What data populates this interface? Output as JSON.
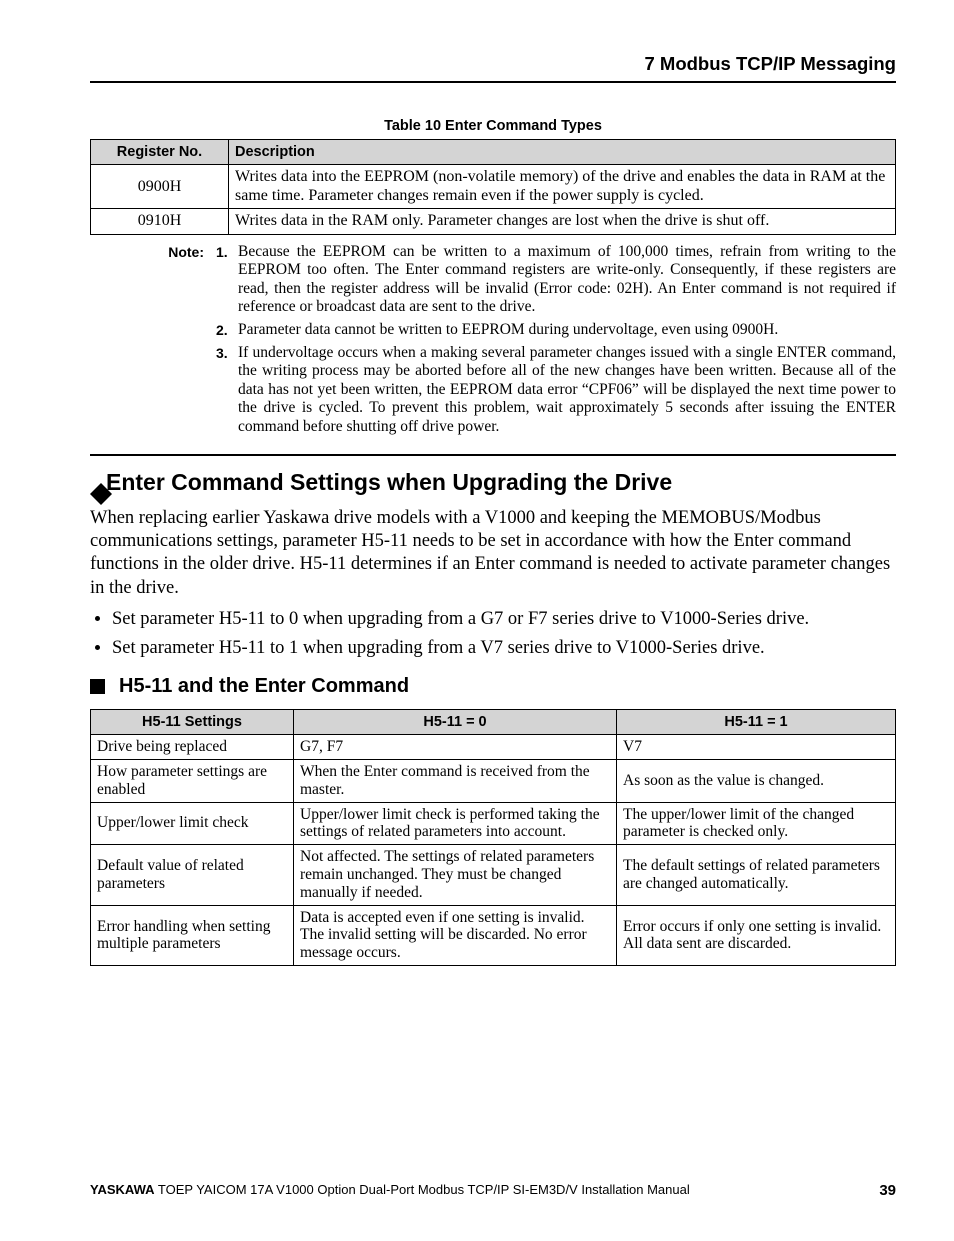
{
  "header": {
    "title": "7  Modbus TCP/IP Messaging"
  },
  "table10": {
    "caption": "Table 10   Enter Command Types",
    "headers": {
      "reg": "Register No.",
      "desc": "Description"
    },
    "rows": [
      {
        "reg": "0900H",
        "desc": "Writes data into the EEPROM (non-volatile memory) of the drive and enables the data in RAM at the same time. Parameter changes remain even if the power supply is cycled."
      },
      {
        "reg": "0910H",
        "desc": "Writes data in the RAM only. Parameter changes are lost when the drive is shut off."
      }
    ]
  },
  "notes": {
    "label": "Note:",
    "items": [
      "Because the EEPROM can be written to a maximum of 100,000 times, refrain from writing to the EEPROM too often. The Enter command registers are write-only. Consequently, if these registers are read, then the register address will be invalid (Error code: 02H). An Enter command is not required if reference or broadcast data are sent to the drive.",
      "Parameter data cannot be written to EEPROM during undervoltage, even using 0900H.",
      "If undervoltage occurs when a making several parameter changes issued with a single ENTER command, the writing process may be aborted before all of the new changes have been written. Because all of the data has not yet been written, the EEPROM data error “CPF06” will be displayed the next time power to the drive is cycled. To prevent this problem, wait approximately 5 seconds after issuing the ENTER command before shutting off drive power."
    ]
  },
  "section": {
    "h2": "Enter Command Settings when Upgrading the Drive",
    "para": "When replacing earlier Yaskawa drive models with a V1000 and keeping the MEMOBUS/Modbus communications settings, parameter H5-11 needs to be set in accordance with how the Enter command functions in the older drive. H5-11 determines if an Enter command is needed to activate parameter changes in the drive.",
    "bullets": [
      "Set parameter H5-11 to 0 when upgrading from a G7 or F7 series drive to V1000-Series drive.",
      "Set parameter H5-11 to 1 when upgrading from a V7 series drive to V1000-Series drive."
    ],
    "h3": "H5-11 and the Enter Command"
  },
  "table11": {
    "headers": {
      "a": "H5-11 Settings",
      "b": "H5-11 = 0",
      "c": "H5-11 = 1"
    },
    "rows": [
      {
        "a": "Drive being replaced",
        "b": "G7, F7",
        "c": "V7"
      },
      {
        "a": "How parameter settings are enabled",
        "b": "When the Enter command is received from the master.",
        "c": "As soon as the value is changed."
      },
      {
        "a": "Upper/lower limit check",
        "b": "Upper/lower limit check is performed taking the settings of related parameters into account.",
        "c": "The upper/lower limit of the changed parameter is checked only."
      },
      {
        "a": "Default value of related parameters",
        "b": "Not affected. The settings of related parameters remain unchanged. They must be changed manually if needed.",
        "c": "The default settings of related parameters are changed automatically."
      },
      {
        "a": "Error handling when setting multiple parameters",
        "b": "Data is accepted even if one setting is invalid. The invalid setting will be discarded. No error message occurs.",
        "c": "Error occurs if only one setting is invalid. All data sent are discarded."
      }
    ]
  },
  "footer": {
    "brand": "YASKAWA",
    "doc": " TOEP YAICOM 17A V1000 Option Dual-Port Modbus TCP/IP SI-EM3D/V Installation Manual",
    "page": "39"
  }
}
